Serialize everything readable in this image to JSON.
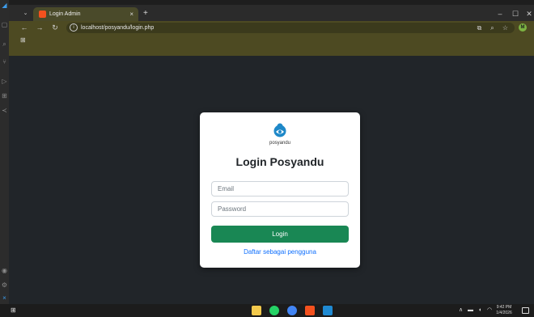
{
  "browser": {
    "tab_title": "Login Admin",
    "tab_close": "×",
    "new_tab": "+",
    "url": "localhost/posyandu/login.php",
    "profile_initial": "M",
    "controls": {
      "minimize": "–",
      "maximize": "☐",
      "close": "✕"
    }
  },
  "login": {
    "logo_text": "posyandu",
    "title": "Login Posyandu",
    "email_placeholder": "Email",
    "password_placeholder": "Password",
    "submit_label": "Login",
    "register_link": "Daftar sebagai pengguna"
  },
  "taskbar": {
    "time": "9:42 PM",
    "date": "1/4/2026"
  },
  "colors": {
    "accent_button": "#198754",
    "link": "#0d6efd",
    "page_background": "#212529"
  }
}
